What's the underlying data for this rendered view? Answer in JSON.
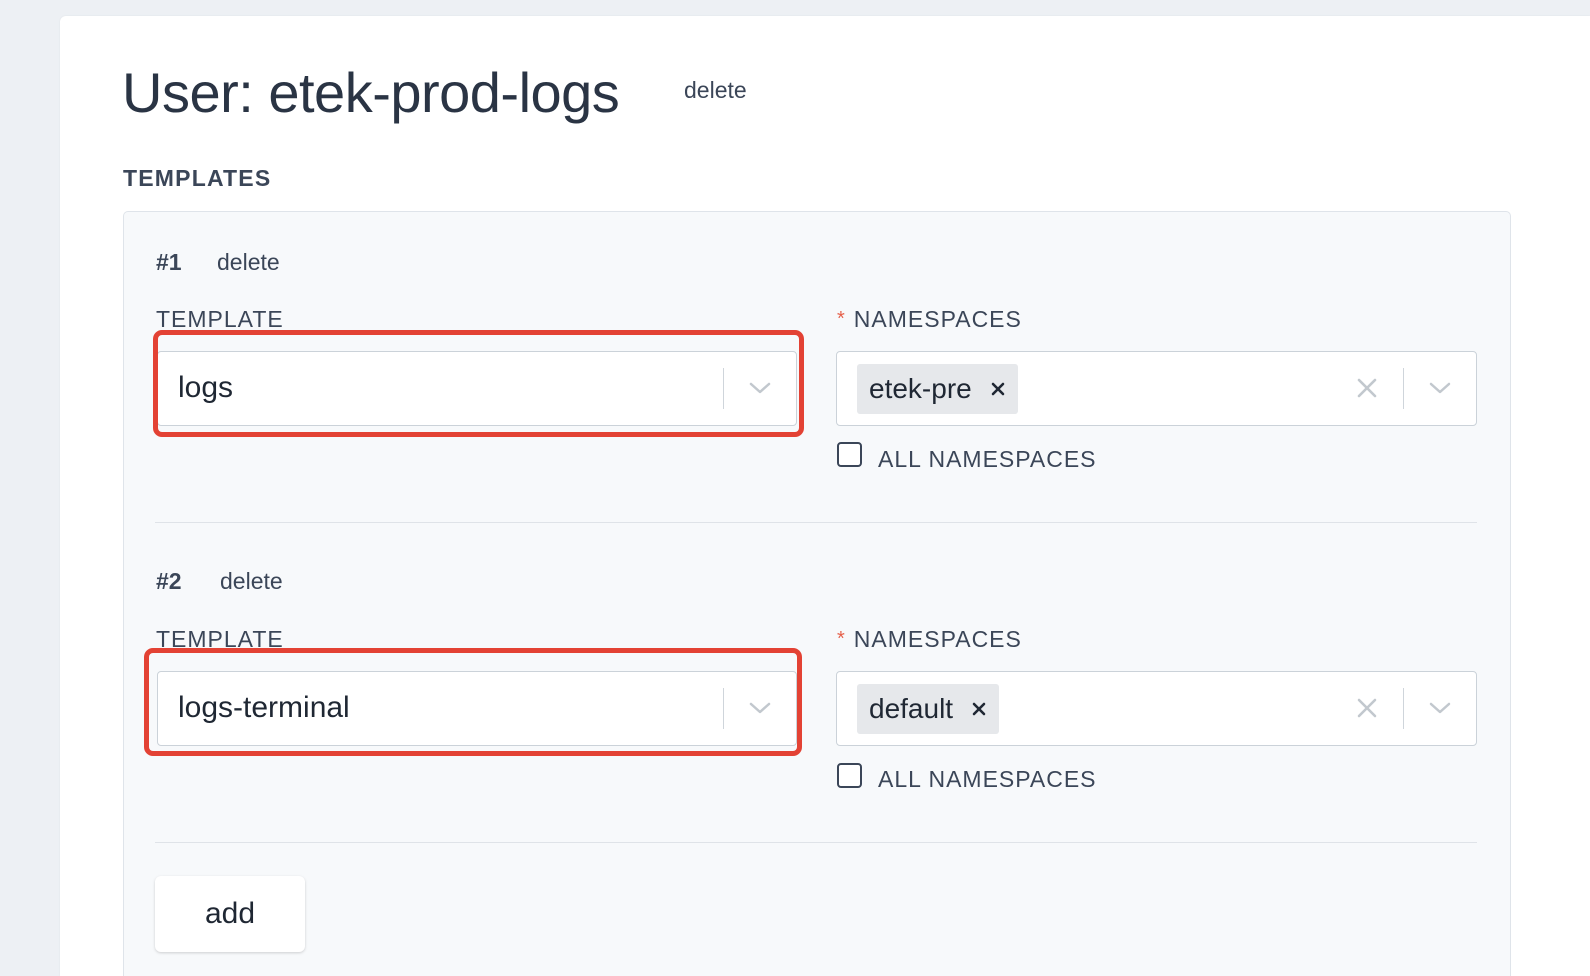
{
  "page": {
    "title": "User: etek-prod-logs",
    "delete_label": "delete"
  },
  "templates_section": {
    "heading": "TEMPLATES",
    "entries": [
      {
        "number": "#1",
        "delete_label": "delete",
        "template_label": "TEMPLATE",
        "template_value": "logs",
        "namespaces_label": "NAMESPACES",
        "required_marker": "*",
        "namespace_tags": [
          "etek-pre"
        ],
        "all_namespaces_label": "ALL NAMESPACES",
        "all_namespaces_checked": false
      },
      {
        "number": "#2",
        "delete_label": "delete",
        "template_label": "TEMPLATE",
        "template_value": "logs-terminal",
        "namespaces_label": "NAMESPACES",
        "required_marker": "*",
        "namespace_tags": [
          "default"
        ],
        "all_namespaces_label": "ALL NAMESPACES",
        "all_namespaces_checked": false
      }
    ],
    "add_label": "add"
  },
  "icons": {
    "dropdown": "chevron-down-icon",
    "clear": "clear-icon",
    "remove_tag": "remove-tag-icon"
  },
  "colors": {
    "background": "#edf0f4",
    "card": "#ffffff",
    "panel": "#f7f9fb",
    "text": "#2d3748",
    "required_star": "#e5604a",
    "highlight": "#e34234",
    "chip": "#e6e8eb"
  }
}
